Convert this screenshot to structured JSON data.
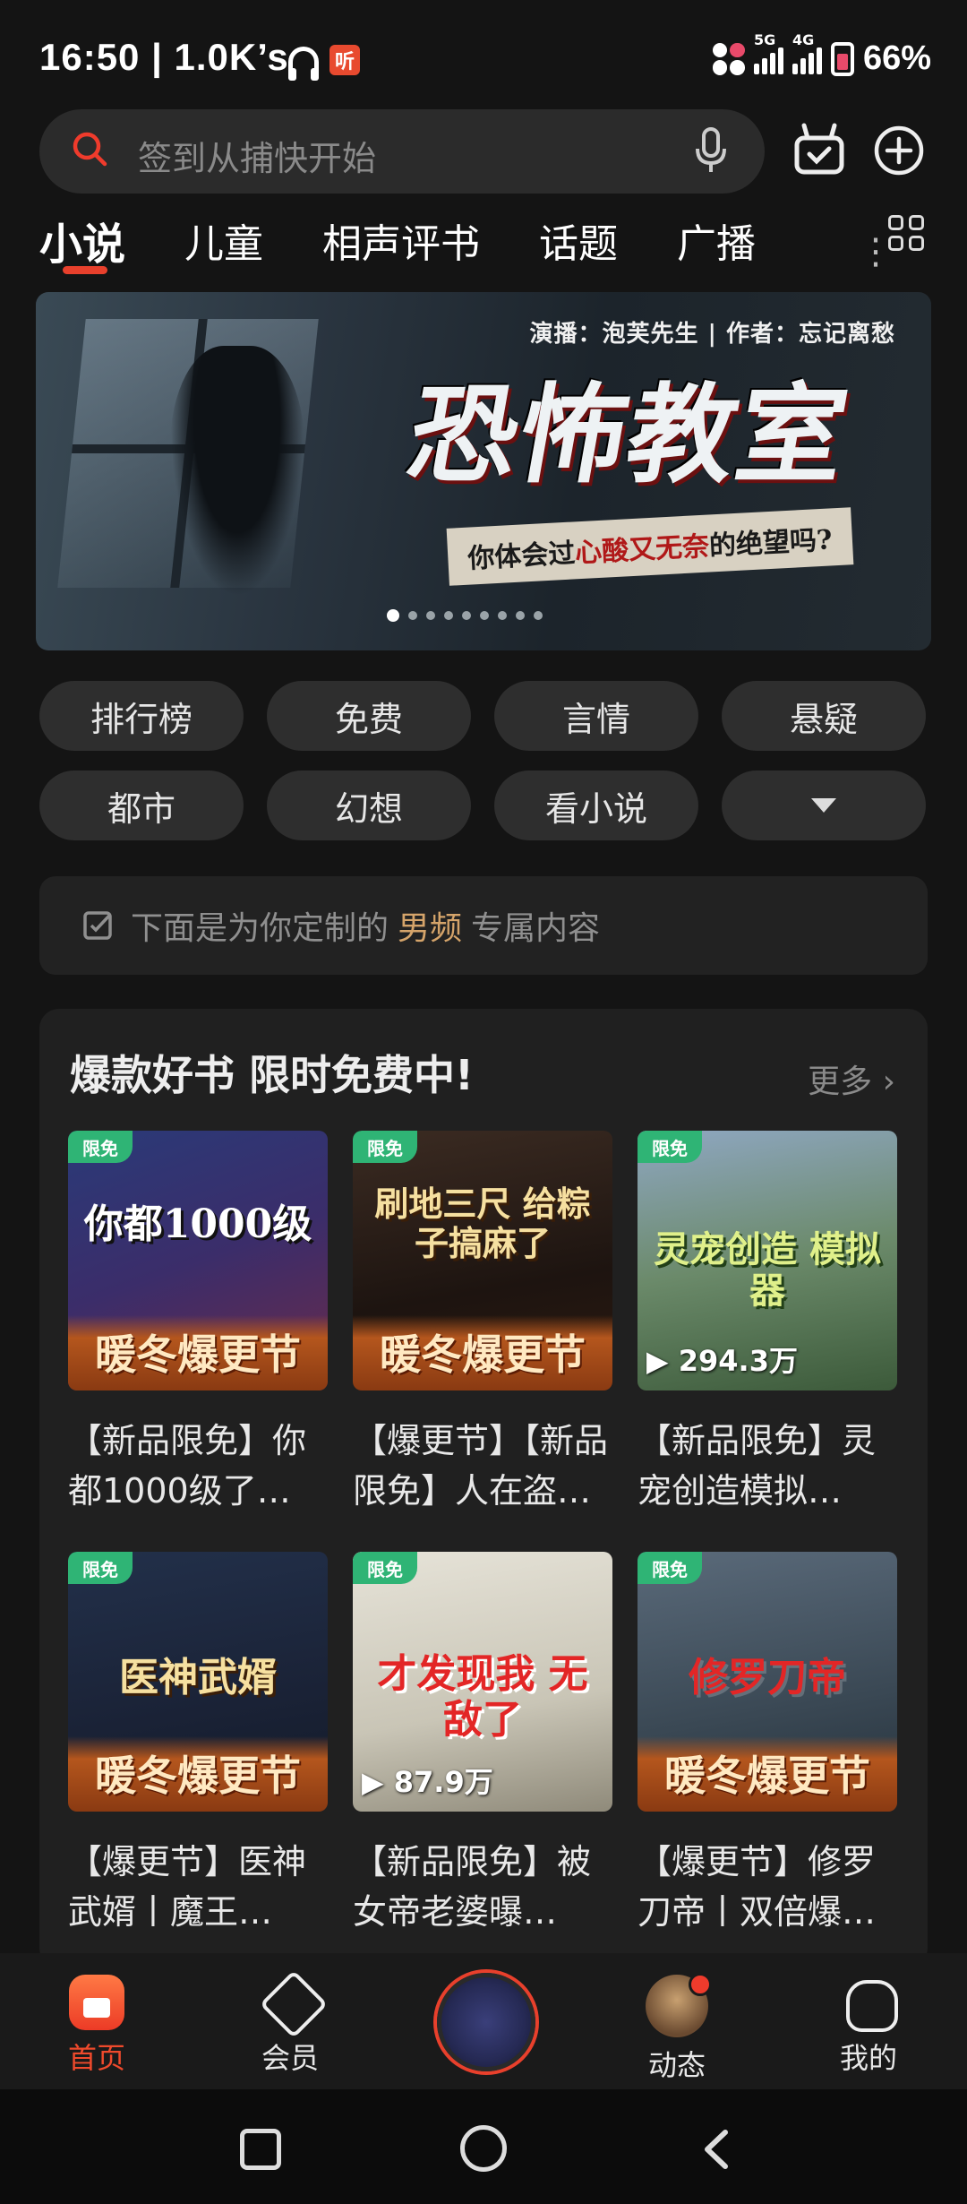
{
  "status_bar": {
    "time": "16:50 | 1.0K’s",
    "ting_label": "听",
    "sig1": "5G",
    "sig2": "4G",
    "battery": "66%"
  },
  "search": {
    "placeholder": "签到从捕快开始"
  },
  "tabs": [
    "小说",
    "儿童",
    "相声评书",
    "话题",
    "广播"
  ],
  "tab_more": "⋮",
  "banner": {
    "credit": "演播：泡芙先生 | 作者：忘记离愁",
    "title": "恐怖教室",
    "tagline_pre": "你体会过",
    "tagline_hl": "心酸又无奈",
    "tagline_post": "的绝望吗?"
  },
  "chips": [
    "排行榜",
    "免费",
    "言情",
    "悬疑",
    "都市",
    "幻想",
    "看小说"
  ],
  "notice": {
    "pre": "下面是为你定制的",
    "highlight": "男频",
    "post": "专属内容"
  },
  "section": {
    "title": "爆款好书 限时免费中!",
    "more": "更多 ›",
    "badge": "限免",
    "festival": "暖冬爆更节",
    "books": [
      {
        "cover_title": "你都1000级",
        "name": "【新品限免】你都1000级了…",
        "plays": ""
      },
      {
        "cover_title": "刷地三尺 给粽子搞麻了",
        "name": "【爆更节】【新品限免】人在盗…",
        "plays": ""
      },
      {
        "cover_title": "灵宠创造 模拟器",
        "name": "【新品限免】灵宠创造模拟…",
        "plays": "▶ 294.3万"
      },
      {
        "cover_title": "医神武婿",
        "name": "【爆更节】医神武婿丨魔王…",
        "plays": ""
      },
      {
        "cover_title": "才发现我 无敌了",
        "name": "【新品限免】被女帝老婆曝…",
        "plays": "▶ 87.9万"
      },
      {
        "cover_title": "修罗刀帝",
        "name": "【爆更节】修罗刀帝丨双倍爆…",
        "plays": ""
      }
    ]
  },
  "bottom_nav": {
    "home": "首页",
    "vip": "会员",
    "feed": "动态",
    "mine": "我的"
  },
  "colors": {
    "accent": "#ef4a2c",
    "badge": "#2fb475",
    "highlight": "#d5a46a"
  }
}
